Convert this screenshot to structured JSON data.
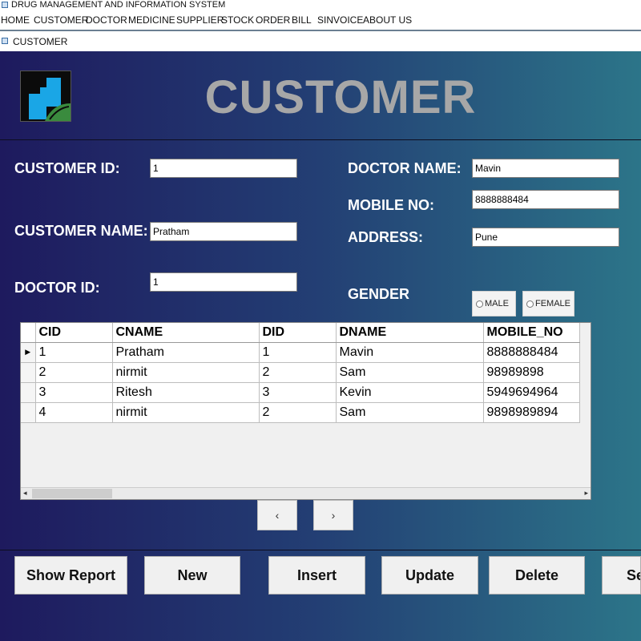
{
  "app": {
    "title": "DRUG MANAGEMENT AND INFORMATION SYSTEM"
  },
  "menu": [
    "HOME",
    "CUSTOMER",
    "DOCTOR",
    "MEDICINE",
    "SUPPLIER",
    "STOCK",
    "ORDER",
    "BILL",
    "SINVOICE",
    "ABOUT US"
  ],
  "child_window": {
    "title": "CUSTOMER"
  },
  "page": {
    "heading": "CUSTOMER"
  },
  "form": {
    "customer_id": {
      "label": "CUSTOMER ID:",
      "value": "1"
    },
    "customer_name": {
      "label": "CUSTOMER NAME:",
      "value": "Pratham"
    },
    "doctor_id": {
      "label": "DOCTOR ID:",
      "value": "1"
    },
    "doctor_name": {
      "label": "DOCTOR NAME:",
      "value": "Mavin"
    },
    "mobile_no": {
      "label": "MOBILE NO:",
      "value": "8888888484"
    },
    "address": {
      "label": "ADDRESS:",
      "value": "Pune"
    },
    "gender": {
      "label": "GENDER",
      "options": [
        "MALE",
        "FEMALE"
      ]
    }
  },
  "grid": {
    "columns": [
      "CID",
      "CNAME",
      "DID",
      "DNAME",
      "MOBILE_NO"
    ],
    "rows": [
      [
        "1",
        "Pratham",
        "1",
        "Mavin",
        "8888888484"
      ],
      [
        "2",
        "nirmit",
        "2",
        "Sam",
        "98989898"
      ],
      [
        "3",
        "Ritesh",
        "3",
        "Kevin",
        "5949694964"
      ],
      [
        "4",
        "nirmit",
        "2",
        "Sam",
        "9898989894"
      ]
    ],
    "current_row_marker": "▶",
    "scroll_left_arrow": "◂",
    "scroll_right_arrow": "▸"
  },
  "pager": {
    "prev_label": "‹",
    "next_label": "›"
  },
  "actions": {
    "show_report": "Show Report",
    "new": "New",
    "insert": "Insert",
    "update": "Update",
    "delete": "Delete",
    "search_partial": "Se"
  },
  "colors": {
    "bg_start": "#1e1a5e",
    "bg_mid": "#233f74",
    "bg_end": "#2c7589",
    "heading": "#a7a7a7"
  },
  "icons": {
    "logo": "pharmacy-logo-icon",
    "app": "app-window-icon"
  }
}
